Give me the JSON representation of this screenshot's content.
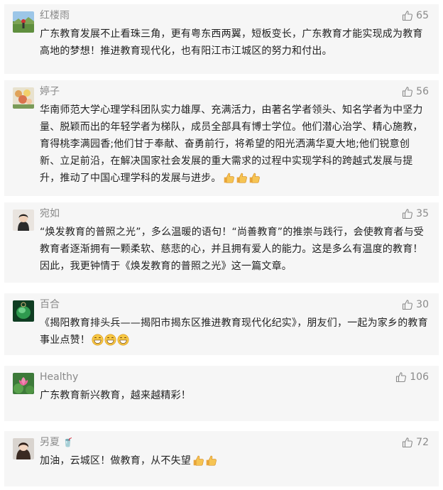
{
  "comments": [
    {
      "nickname": "红楼雨",
      "likes": "65",
      "text": "广东教育发展不止看珠三角，更有粤东西两翼，短板变长，广东教育才能实现成为教育高地的梦想！推进教育现代化，也有阳江市江城区的努力和付出。",
      "avatar": "landscape-avatar"
    },
    {
      "nickname": "婷子",
      "likes": "56",
      "text": "华南师范大学心理学科团队实力雄厚、充满活力，由著名学者领头、知名学者为中坚力量、脱颖而出的年轻学者为梯队，成员全部具有博士学位。他们潜心治学、精心施教，育得桃李满园香;他们甘于奉献、奋勇前行，将希望的阳光洒满华夏大地;他们锐意创新、立足前沿，在解决国家社会发展的重大需求的过程中实现学科的跨越式发展与提升，推动了中国心理学科的发展与进步。",
      "emojis": [
        "thumbs-up-emoji",
        "thumbs-up-emoji",
        "thumbs-up-emoji"
      ],
      "avatar": "flowers-avatar"
    },
    {
      "nickname": "宛如",
      "likes": "35",
      "text": "“焕发教育的普照之光”，多么温暖的语句！“尚善教育”的推崇与践行，会使教育者与受教育者逐渐拥有一颗柔软、慈悲的心，并且拥有爱人的能力。这是多么有温度的教育！因此，我更钟情于《焕发教育的普照之光》这一篇文章。",
      "avatar": "portrait-avatar"
    },
    {
      "nickname": "百合",
      "likes": "30",
      "text": "《揭阳教育排头兵——揭阳市揭东区推进教育现代化纪实》，朋友们，一起为家乡的教育事业点赞！",
      "emojis": [
        "grin-emoji",
        "grin-emoji",
        "grin-emoji"
      ],
      "avatar": "jade-avatar"
    },
    {
      "nickname": "Healthy",
      "likes": "106",
      "text": "广东教育新兴教育，越来越精彩！",
      "avatar": "lotus-avatar"
    },
    {
      "nickname": "另夏",
      "nickname_extra": "🥤",
      "likes": "72",
      "text": "加油，云城区！做教育，从不失望",
      "emojis": [
        "thumbs-up-emoji",
        "thumbs-up-emoji"
      ],
      "avatar": "woman-avatar"
    }
  ],
  "colors": {
    "card_bg": "#f6f6f6",
    "meta_text": "#8a8a8a",
    "body_text": "#222222"
  }
}
